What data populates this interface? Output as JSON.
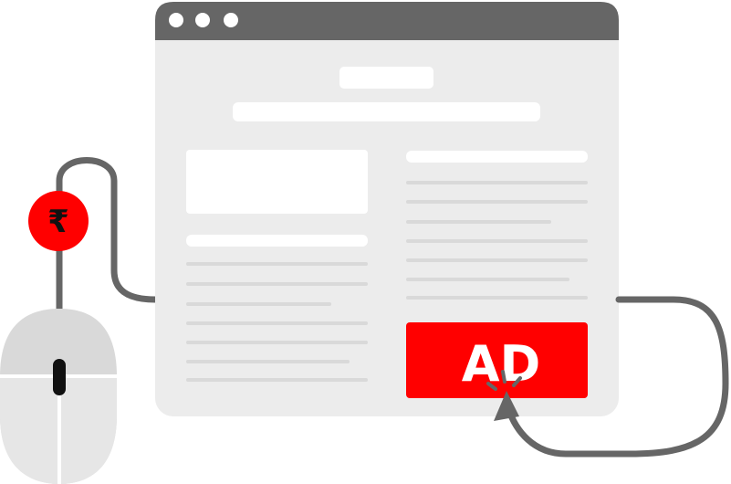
{
  "ad_banner": {
    "label": "AD"
  },
  "payment": {
    "currency_symbol": "₹"
  },
  "icons": {
    "payment_badge": "rupee-coin-icon",
    "mouse": "computer-mouse-icon",
    "cursor": "arrow-cursor-icon",
    "click_burst": "click-burst-icon"
  },
  "colors": {
    "frame_gray": "#666666",
    "page_background": "#ececec",
    "placeholder_white": "#ffffff",
    "text_line_gray": "#d9d9d9",
    "ad_red": "#ff0000",
    "mouse_body": "#d9d9d9",
    "mouse_buttons": "#e6e6e6",
    "mouse_divider": "#ffffff",
    "scroll_wheel": "#111111"
  }
}
